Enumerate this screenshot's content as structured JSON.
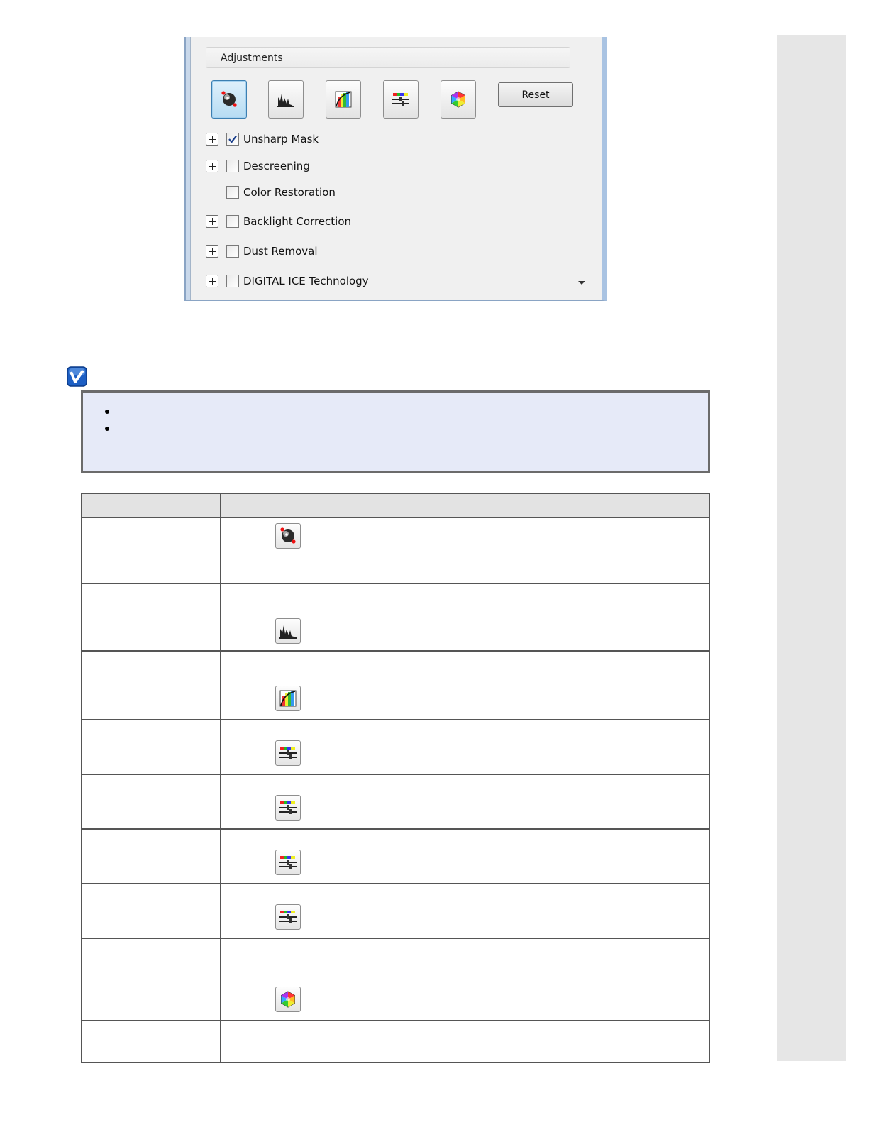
{
  "panel": {
    "header": "Adjustments",
    "tools": [
      {
        "name": "unsharp-mask-tool",
        "icon": "sphere-icon"
      },
      {
        "name": "histogram-tool",
        "icon": "histogram-icon"
      },
      {
        "name": "tone-curve-tool",
        "icon": "tone-curve-icon"
      },
      {
        "name": "image-adjustment-tool",
        "icon": "sliders-icon"
      },
      {
        "name": "color-palette-tool",
        "icon": "color-wheel-icon"
      }
    ],
    "reset_label": "Reset",
    "options": [
      {
        "label": "Unsharp Mask",
        "checked": true,
        "expandable": true
      },
      {
        "label": "Descreening",
        "checked": false,
        "expandable": true
      },
      {
        "label": "Color Restoration",
        "checked": false,
        "expandable": false
      },
      {
        "label": "Backlight Correction",
        "checked": false,
        "expandable": true
      },
      {
        "label": "Dust Removal",
        "checked": false,
        "expandable": true
      },
      {
        "label": "DIGITAL ICE Technology",
        "checked": false,
        "expandable": true
      }
    ]
  },
  "table": {
    "rows": [
      {
        "icon": "sphere-icon"
      },
      {
        "icon": "histogram-icon"
      },
      {
        "icon": "tone-curve-icon"
      },
      {
        "icon": "sliders-icon"
      },
      {
        "icon": "sliders-icon"
      },
      {
        "icon": "sliders-icon"
      },
      {
        "icon": "sliders-icon"
      },
      {
        "icon": "color-wheel-icon"
      },
      {
        "icon": ""
      }
    ]
  },
  "colors": {
    "note_bg": "#e6eaf8",
    "header_bg": "#e3e3e3",
    "active_tool": "#b6dcf3"
  }
}
